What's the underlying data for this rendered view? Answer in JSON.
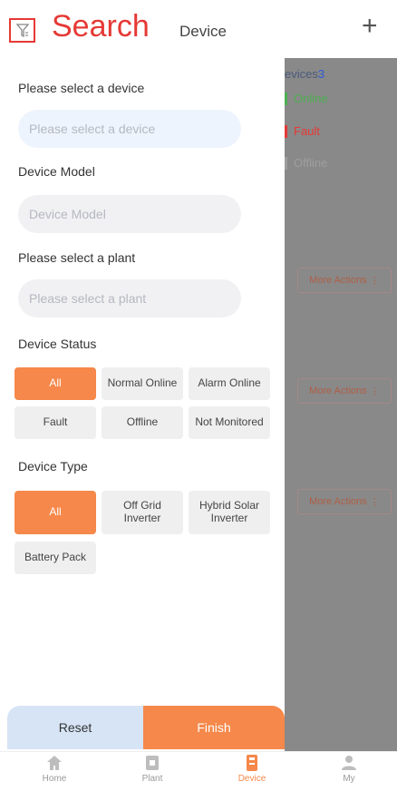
{
  "header": {
    "search_label": "Search",
    "title": "Device",
    "filter_icon": "filter-icon",
    "add_icon": "plus-icon"
  },
  "background": {
    "device_count_prefix": "evices",
    "device_count": "3",
    "statuses": [
      {
        "label": "Online",
        "color": "#4caf50"
      },
      {
        "label": "Fault",
        "color": "#e53935"
      },
      {
        "label": "Offline",
        "color": "#9e9e9e"
      }
    ],
    "more_actions": [
      "More Actions",
      "More Actions",
      "More Actions"
    ]
  },
  "filter": {
    "device_label": "Please select a device",
    "device_placeholder": "Please select a device",
    "model_label": "Device Model",
    "model_placeholder": "Device Model",
    "plant_label": "Please select a plant",
    "plant_placeholder": "Please select a plant",
    "status_label": "Device Status",
    "status_options": [
      "All",
      "Normal Online",
      "Alarm Online",
      "Fault",
      "Offline",
      "Not Monitored"
    ],
    "status_selected": "All",
    "type_label": "Device Type",
    "type_options": [
      "All",
      "Off Grid\nInverter",
      "Hybrid Solar\nInverter",
      "Battery Pack"
    ],
    "type_selected": "All",
    "reset_label": "Reset",
    "finish_label": "Finish"
  },
  "nav": {
    "items": [
      {
        "label": "Home",
        "icon": "home-icon"
      },
      {
        "label": "Plant",
        "icon": "plant-icon"
      },
      {
        "label": "Device",
        "icon": "device-icon"
      },
      {
        "label": "My",
        "icon": "user-icon"
      }
    ],
    "active": "Device"
  },
  "colors": {
    "accent": "#f5884a",
    "search_red": "#e53935",
    "chip_bg": "#efefef",
    "overlay": "#898989"
  }
}
